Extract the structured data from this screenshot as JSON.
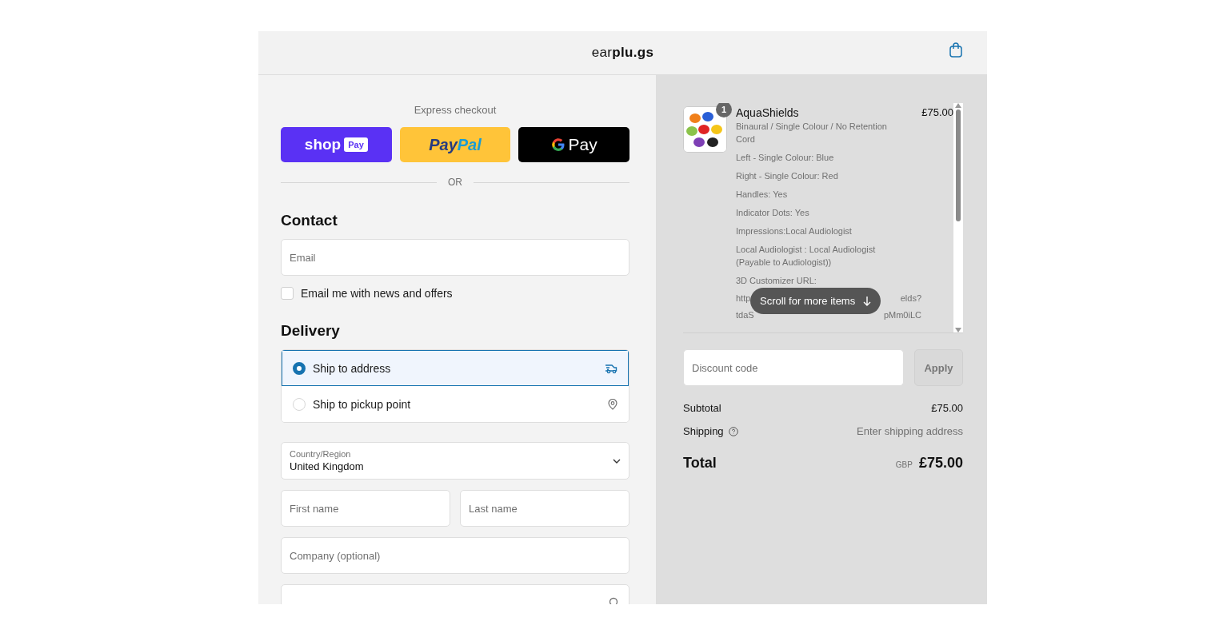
{
  "header": {
    "logo": "ear**plu.gs**"
  },
  "express_checkout": {
    "title": "Express checkout",
    "divider": "OR",
    "buttons": [
      {
        "kind": "shop_pay",
        "label": "shop",
        "label_2": "Pay"
      },
      {
        "kind": "paypal",
        "label": "Pay",
        "label_2": "Pal"
      },
      {
        "kind": "google_pay",
        "label": "Pay"
      }
    ]
  },
  "contact": {
    "heading": "Contact",
    "email_placeholder": "Email",
    "newsletter": {
      "label": "Email me with news and offers",
      "checked": false
    }
  },
  "delivery": {
    "heading": "Delivery",
    "options": [
      {
        "kind": "ship",
        "label": "Ship to address",
        "selected": true
      },
      {
        "kind": "pickup",
        "label": "Ship to pickup point",
        "selected": false
      }
    ],
    "country": {
      "label": "Country/Region",
      "value": "United Kingdom"
    },
    "field_rows": [
      [
        {
          "kind": "text",
          "placeholder": "First name"
        },
        {
          "kind": "text",
          "placeholder": "Last name"
        }
      ],
      [
        {
          "kind": "text",
          "placeholder": "Company (optional)"
        }
      ],
      [
        {
          "kind": "address"
        }
      ]
    ]
  },
  "cart": {
    "items": [
      {
        "name": "AquaShields",
        "quantity": "1",
        "price": "£75.00",
        "variant": "Binaural / Single Colour / No Retention Cord",
        "properties": [
          "Left - Single Colour: Blue",
          "Right - Single Colour: Red",
          "Handles: Yes",
          "Indicator Dots: Yes",
          "Impressions:Local Audiologist",
          "Local Audiologist : Local Audiologist (Payable to Audiologist))",
          "3D Customizer URL:"
        ],
        "url_fragments": [
          {
            "left": "http",
            "right": "elds?"
          },
          {
            "left": "tdaS",
            "right": "pMm0iLC"
          }
        ]
      }
    ],
    "scroll_hint": "Scroll for more items"
  },
  "discount": {
    "placeholder": "Discount code",
    "button": "Apply",
    "disabled": true
  },
  "summary": {
    "subtotal_label": "Subtotal",
    "subtotal": "£75.00",
    "shipping_label": "Shipping",
    "shipping": "Enter shipping address",
    "total_label": "Total",
    "currency": "GBP",
    "total": "£75.00"
  }
}
